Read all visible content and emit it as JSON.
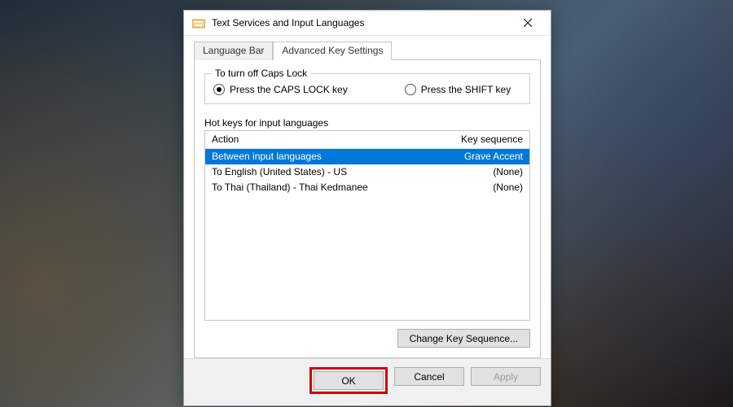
{
  "window": {
    "title": "Text Services and Input Languages"
  },
  "tabs": {
    "language_bar": "Language Bar",
    "advanced_key": "Advanced Key Settings"
  },
  "capslock": {
    "legend": "To turn off Caps Lock",
    "opt_capslock": "Press the CAPS LOCK key",
    "opt_shift": "Press the SHIFT key"
  },
  "hotkeys": {
    "label": "Hot keys for input languages",
    "col_action": "Action",
    "col_keyseq": "Key sequence",
    "rows": [
      {
        "action": "Between input languages",
        "keyseq": "Grave Accent",
        "selected": true
      },
      {
        "action": "To English (United States) - US",
        "keyseq": "(None)",
        "selected": false
      },
      {
        "action": "To Thai (Thailand) - Thai Kedmanee",
        "keyseq": "(None)",
        "selected": false
      }
    ],
    "change_button": "Change Key Sequence..."
  },
  "buttons": {
    "ok": "OK",
    "cancel": "Cancel",
    "apply": "Apply"
  }
}
